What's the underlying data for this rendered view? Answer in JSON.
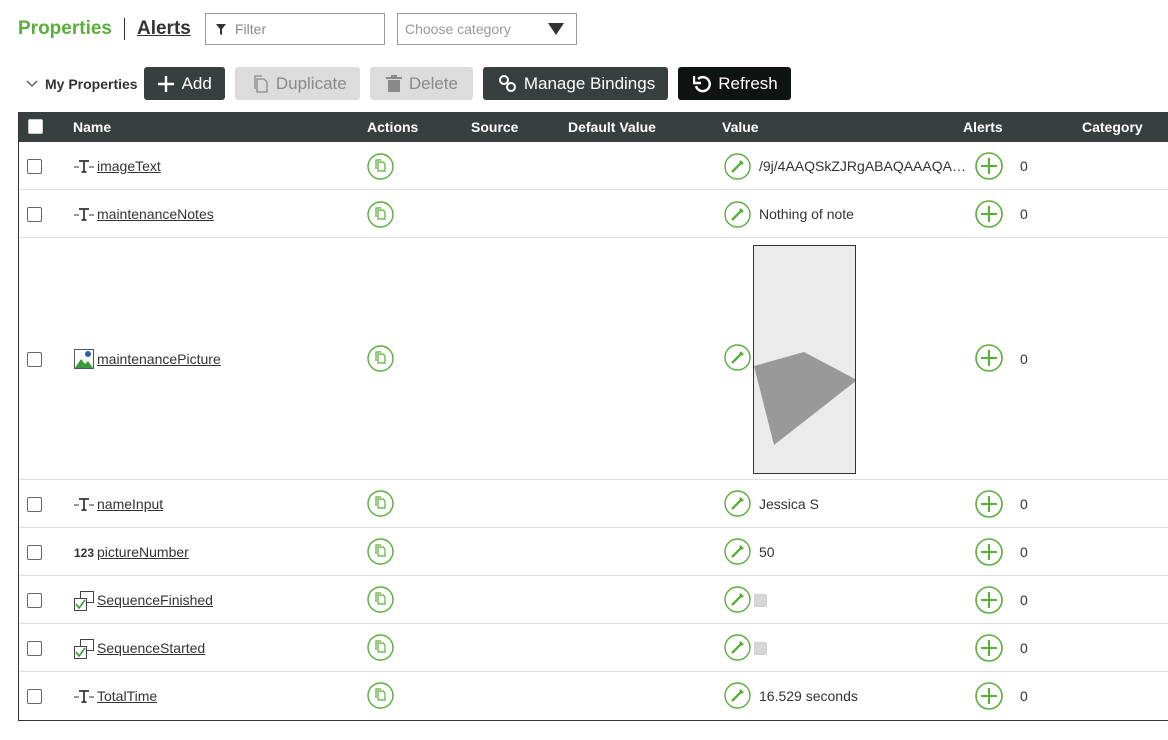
{
  "header": {
    "tab_properties": "Properties",
    "tab_alerts": "Alerts",
    "filter_placeholder": "Filter",
    "category_placeholder": "Choose category"
  },
  "toolbar": {
    "section_label": "My Properties",
    "add_label": "Add",
    "duplicate_label": "Duplicate",
    "delete_label": "Delete",
    "manage_bindings_label": "Manage Bindings",
    "refresh_label": "Refresh"
  },
  "columns": {
    "name": "Name",
    "actions": "Actions",
    "source": "Source",
    "default_value": "Default Value",
    "value": "Value",
    "alerts": "Alerts",
    "category": "Category"
  },
  "rows": [
    {
      "name": "imageText",
      "type_icon": "text-type-icon",
      "value": "/9j/4AAQSkZJRgABAQAAAQABAAD",
      "alerts": "0"
    },
    {
      "name": "maintenanceNotes",
      "type_icon": "text-type-icon",
      "value": "Nothing of note",
      "alerts": "0"
    },
    {
      "name": "maintenancePicture",
      "type_icon": "image-type-icon",
      "value": "",
      "alerts": "0"
    },
    {
      "name": "nameInput",
      "type_icon": "text-type-icon",
      "value": "Jessica S",
      "alerts": "0"
    },
    {
      "name": "pictureNumber",
      "type_icon": "number-type-icon",
      "type_label": "123",
      "value": "50",
      "alerts": "0"
    },
    {
      "name": "SequenceFinished",
      "type_icon": "boolean-type-icon",
      "value": "",
      "alerts": "0"
    },
    {
      "name": "SequenceStarted",
      "type_icon": "boolean-type-icon",
      "value": "",
      "alerts": "0"
    },
    {
      "name": "TotalTime",
      "type_icon": "text-type-icon",
      "value": "16.529 seconds",
      "alerts": "0"
    }
  ],
  "colors": {
    "accent_green": "#5aae3c",
    "header_dark": "#37403e",
    "refresh_black": "#0f1412"
  }
}
